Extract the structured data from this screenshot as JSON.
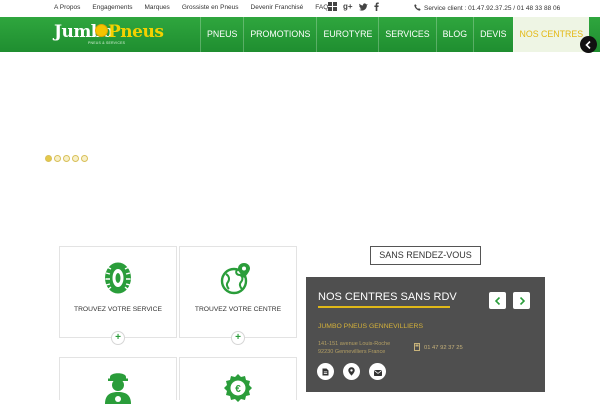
{
  "topbar": {
    "links": [
      "A Propos",
      "Engagements",
      "Marques",
      "Grossiste en Pneus",
      "Devenir Franchisé",
      "FAQ"
    ],
    "social_icons": [
      "grid-icon",
      "google-plus-icon",
      "twitter-icon",
      "facebook-icon"
    ],
    "service_label": "Service client : 01.47.92.37.25 / 01 48 33 88 06"
  },
  "logo": {
    "word1": "Jumbo",
    "word2": "Pneus",
    "tagline": "PNEUS & SERVICES"
  },
  "nav": {
    "items": [
      {
        "label": "PNEUS",
        "active": false
      },
      {
        "label": "PROMOTIONS",
        "active": false
      },
      {
        "label": "EUROTYRE",
        "active": false
      },
      {
        "label": "SERVICES",
        "active": false
      },
      {
        "label": "BLOG",
        "active": false
      },
      {
        "label": "DEVIS",
        "active": false
      },
      {
        "label": "NOS CENTRES",
        "active": true
      }
    ]
  },
  "slider": {
    "dots_count": 5,
    "active_dot": 0
  },
  "cards": [
    {
      "label": "TROUVEZ VOTRE SERVICE",
      "icon": "tire-icon"
    },
    {
      "label": "TROUVEZ VOTRE CENTRE",
      "icon": "globe-pin-icon"
    },
    {
      "label": "",
      "icon": "mechanic-icon"
    },
    {
      "label": "",
      "icon": "euro-badge-icon"
    }
  ],
  "rdv": {
    "heading": "SANS RENDEZ-VOUS",
    "panel_title": "NOS CENTRES SANS RDV",
    "center_name": "JUMBO PNEUS GENNEVILLIERS",
    "address_line1": "141-151 avenue Louis-Roche",
    "address_line2": "92230 Gennevilliers France",
    "phone": "01 47 92 37 25"
  },
  "colors": {
    "brand_green": "#2a9d3a",
    "brand_yellow": "#e4b814",
    "panel_gray": "#4f4f4f"
  }
}
